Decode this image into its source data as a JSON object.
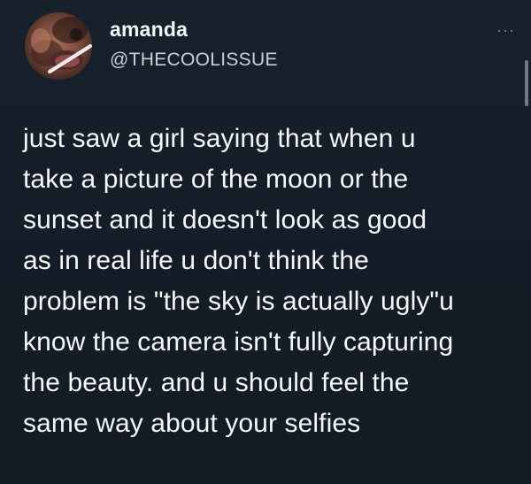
{
  "tweet": {
    "author": {
      "name": "amanda",
      "handle": "@THECOOLISSUE",
      "avatar_icon": "profile-photo",
      "more_icon": "more-options-icon",
      "more_glyph": "···"
    },
    "text_lines": [
      "just saw a girl saying that when u",
      "take a picture of the moon or the",
      "sunset and it doesn't look as good",
      "as in real life u don't think the",
      "problem is \"the sky is actually ugly\"u",
      "know the camera isn't fully capturing",
      "the beauty. and u should feel the",
      "same way about your selfies"
    ]
  },
  "colors": {
    "background": "#15202b",
    "text": "#f6f7f8",
    "secondary_text": "#c7d0d8",
    "muted_icon": "#75818b"
  }
}
